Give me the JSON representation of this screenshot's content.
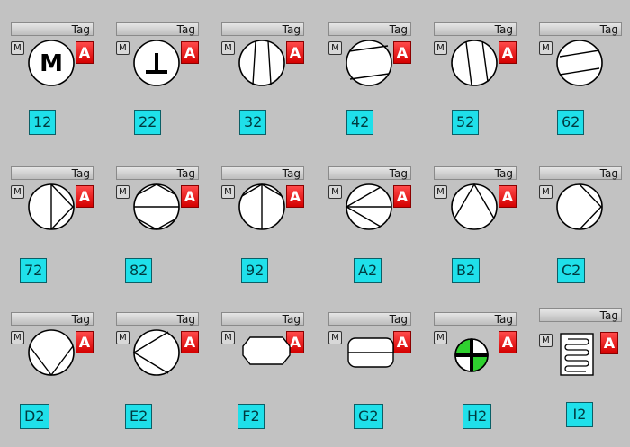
{
  "tag_label": "Tag",
  "m_label": "M",
  "a_label": "A",
  "colors": {
    "background": "#c2c2c2",
    "number_badge": "#1fe0ea",
    "alarm_button": "#e00000",
    "green_quadrant": "#2fd12f"
  },
  "symbols": [
    {
      "id": "12",
      "icon": "motor-m-icon"
    },
    {
      "id": "22",
      "icon": "motor-inverted-t-icon"
    },
    {
      "id": "32",
      "icon": "pump-parallel-lines-icon"
    },
    {
      "id": "42",
      "icon": "pump-angled-lines-icon"
    },
    {
      "id": "52",
      "icon": "pump-angled-lines-icon"
    },
    {
      "id": "62",
      "icon": "pump-angled-lines-icon"
    },
    {
      "id": "72",
      "icon": "pump-triangle-right-icon"
    },
    {
      "id": "82",
      "icon": "pump-triangle-right-icon"
    },
    {
      "id": "92",
      "icon": "pump-triangle-down-icon"
    },
    {
      "id": "A2",
      "icon": "pump-triangle-left-icon"
    },
    {
      "id": "B2",
      "icon": "pump-triangle-up-icon"
    },
    {
      "id": "C2",
      "icon": "pump-arrow-right-icon"
    },
    {
      "id": "D2",
      "icon": "pump-arrow-down-icon"
    },
    {
      "id": "E2",
      "icon": "pump-arrow-left-icon"
    },
    {
      "id": "F2",
      "icon": "octagon-tank-icon"
    },
    {
      "id": "G2",
      "icon": "rounded-tank-icon"
    },
    {
      "id": "H2",
      "icon": "green-quadrant-circle-icon"
    },
    {
      "id": "I2",
      "icon": "coil-heat-exchanger-icon"
    }
  ]
}
